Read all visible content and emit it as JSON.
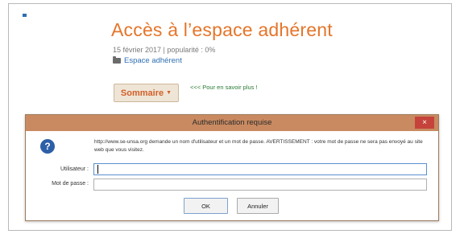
{
  "page": {
    "title": "Accès à l’espace adhérent",
    "meta": "15 février 2017 | popularité : 0%",
    "category": "Espace adhérent",
    "summary_button": "Sommaire",
    "summary_caret": "▼",
    "learn_more": "<<< Pour en savoir plus !"
  },
  "dialog": {
    "title": "Authentification requise",
    "close_label": "×",
    "info_glyph": "?",
    "message": "http://www.se-unsa.org demande un nom d'utilisateur et un mot de passe. AVERTISSEMENT : votre mot de passe ne sera pas envoyé au site web que vous visitez.",
    "username_label": "Utilisateur :",
    "username_value": "",
    "password_label": "Mot de passe :",
    "password_value": "",
    "ok_label": "OK",
    "cancel_label": "Annuler"
  },
  "colors": {
    "title_orange": "#e5752a",
    "link_blue": "#2f6fb3",
    "dialog_titlebar": "#c98a61",
    "close_red": "#c5433a",
    "learn_more_green": "#2a7a34"
  }
}
